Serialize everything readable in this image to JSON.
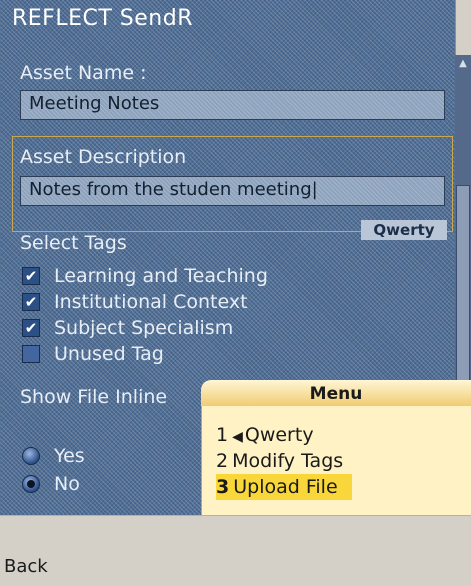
{
  "app": {
    "title": "REFLECT SendR"
  },
  "form": {
    "asset_name_label": "Asset Name :",
    "asset_name_value": "Meeting Notes",
    "asset_description_label": "Asset Description",
    "asset_description_value": "Notes from the studen meeting|",
    "input_mode": "Qwerty",
    "tags_label": "Select Tags",
    "tags": [
      {
        "label": "Learning and Teaching",
        "checked": true
      },
      {
        "label": "Institutional Context",
        "checked": true
      },
      {
        "label": "Subject Specialism",
        "checked": true
      },
      {
        "label": "Unused Tag",
        "checked": false
      }
    ],
    "show_file_label": "Show File Inline",
    "radio": [
      {
        "label": "Yes",
        "selected": false
      },
      {
        "label": "No",
        "selected": true
      }
    ]
  },
  "menu": {
    "title": "Menu",
    "items": [
      {
        "num": "1",
        "arrow": "◀",
        "label": "Qwerty",
        "selected": false
      },
      {
        "num": "2",
        "arrow": "",
        "label": "Modify Tags",
        "selected": false
      },
      {
        "num": "3",
        "arrow": "",
        "label": "Upload File",
        "selected": true
      }
    ]
  },
  "softkeys": {
    "left": "Back"
  },
  "icons": {
    "scroll_up": "triangle-up-icon"
  },
  "colors": {
    "background": "#4f6e96",
    "menu_bg": "#fff2c4",
    "menu_selected": "#f9d73a"
  }
}
